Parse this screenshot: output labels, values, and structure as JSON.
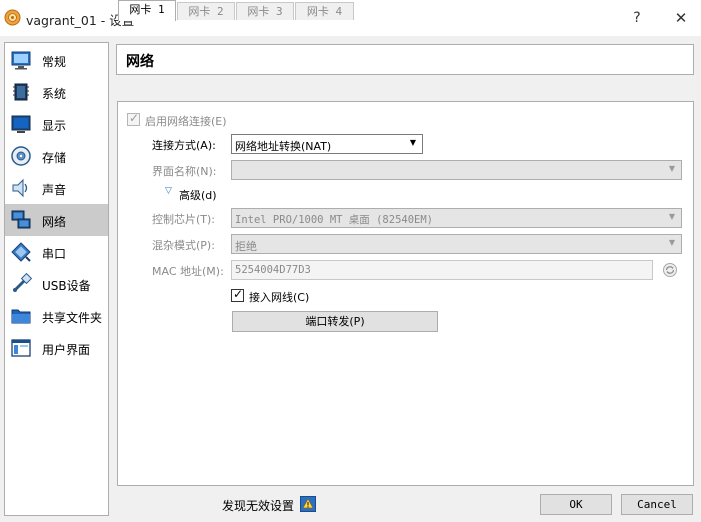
{
  "window": {
    "title": "vagrant_01 - 设置",
    "help_glyph": "?",
    "close_glyph": "✕"
  },
  "sidebar": {
    "items": [
      {
        "label": "常规",
        "icon": "general-icon"
      },
      {
        "label": "系统",
        "icon": "system-chip-icon"
      },
      {
        "label": "显示",
        "icon": "monitor-icon"
      },
      {
        "label": "存储",
        "icon": "storage-disc-icon"
      },
      {
        "label": "声音",
        "icon": "speaker-icon"
      },
      {
        "label": "网络",
        "icon": "network-icon"
      },
      {
        "label": "串口",
        "icon": "serial-port-icon"
      },
      {
        "label": "USB设备",
        "icon": "usb-icon"
      },
      {
        "label": "共享文件夹",
        "icon": "folder-icon"
      },
      {
        "label": "用户界面",
        "icon": "ui-icon"
      }
    ],
    "selected_index": 5
  },
  "page": {
    "title": "网络"
  },
  "tabs": [
    {
      "label": "网卡 1",
      "active": true
    },
    {
      "label": "网卡 2",
      "active": false
    },
    {
      "label": "网卡 3",
      "active": false
    },
    {
      "label": "网卡 4",
      "active": false
    }
  ],
  "network": {
    "enable_label": "启用网络连接(E)",
    "enable_checked": true,
    "attached_label": "连接方式(A):",
    "attached_value": "网络地址转换(NAT)",
    "name_label": "界面名称(N):",
    "name_value": "",
    "advanced_label": "高级(d)",
    "adapter_label": "控制芯片(T):",
    "adapter_value": "Intel PRO/1000 MT 桌面 (82540EM)",
    "promisc_label": "混杂模式(P):",
    "promisc_value": "拒绝",
    "mac_label": "MAC 地址(M):",
    "mac_value": "5254004D77D3",
    "cable_label": "接入网线(C)",
    "cable_checked": true,
    "port_forward_label": "端口转发(P)"
  },
  "footer": {
    "invalid_label": "发现无效设置",
    "ok_label": "OK",
    "cancel_label": "Cancel"
  },
  "colors": {
    "selected_bg": "#cbcbcb",
    "disabled_text": "#8a8a8a",
    "accent_blue": "#2b7cd3"
  }
}
